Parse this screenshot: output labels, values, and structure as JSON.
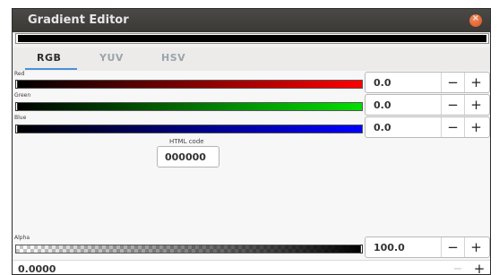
{
  "window": {
    "title": "Gradient Editor",
    "close_glyph": "×"
  },
  "tabs": [
    {
      "label": "RGB",
      "active": true
    },
    {
      "label": "YUV",
      "active": false
    },
    {
      "label": "HSV",
      "active": false
    }
  ],
  "channels": {
    "red": {
      "label": "Red",
      "value": "0.0"
    },
    "green": {
      "label": "Green",
      "value": "0.0"
    },
    "blue": {
      "label": "Blue",
      "value": "0.0"
    },
    "alpha": {
      "label": "Alpha",
      "value": "100.0"
    }
  },
  "html_code": {
    "label": "HTML code",
    "value": "000000"
  },
  "stop_position": {
    "value": "0.0000"
  },
  "spin": {
    "minus": "−",
    "plus": "+"
  },
  "colors": {
    "accent": "#4a90d9",
    "close": "#df5a24",
    "titlebar": "#3e3d3a"
  },
  "icons": {
    "close": "close-icon",
    "minus": "minus-icon",
    "plus": "plus-icon"
  }
}
